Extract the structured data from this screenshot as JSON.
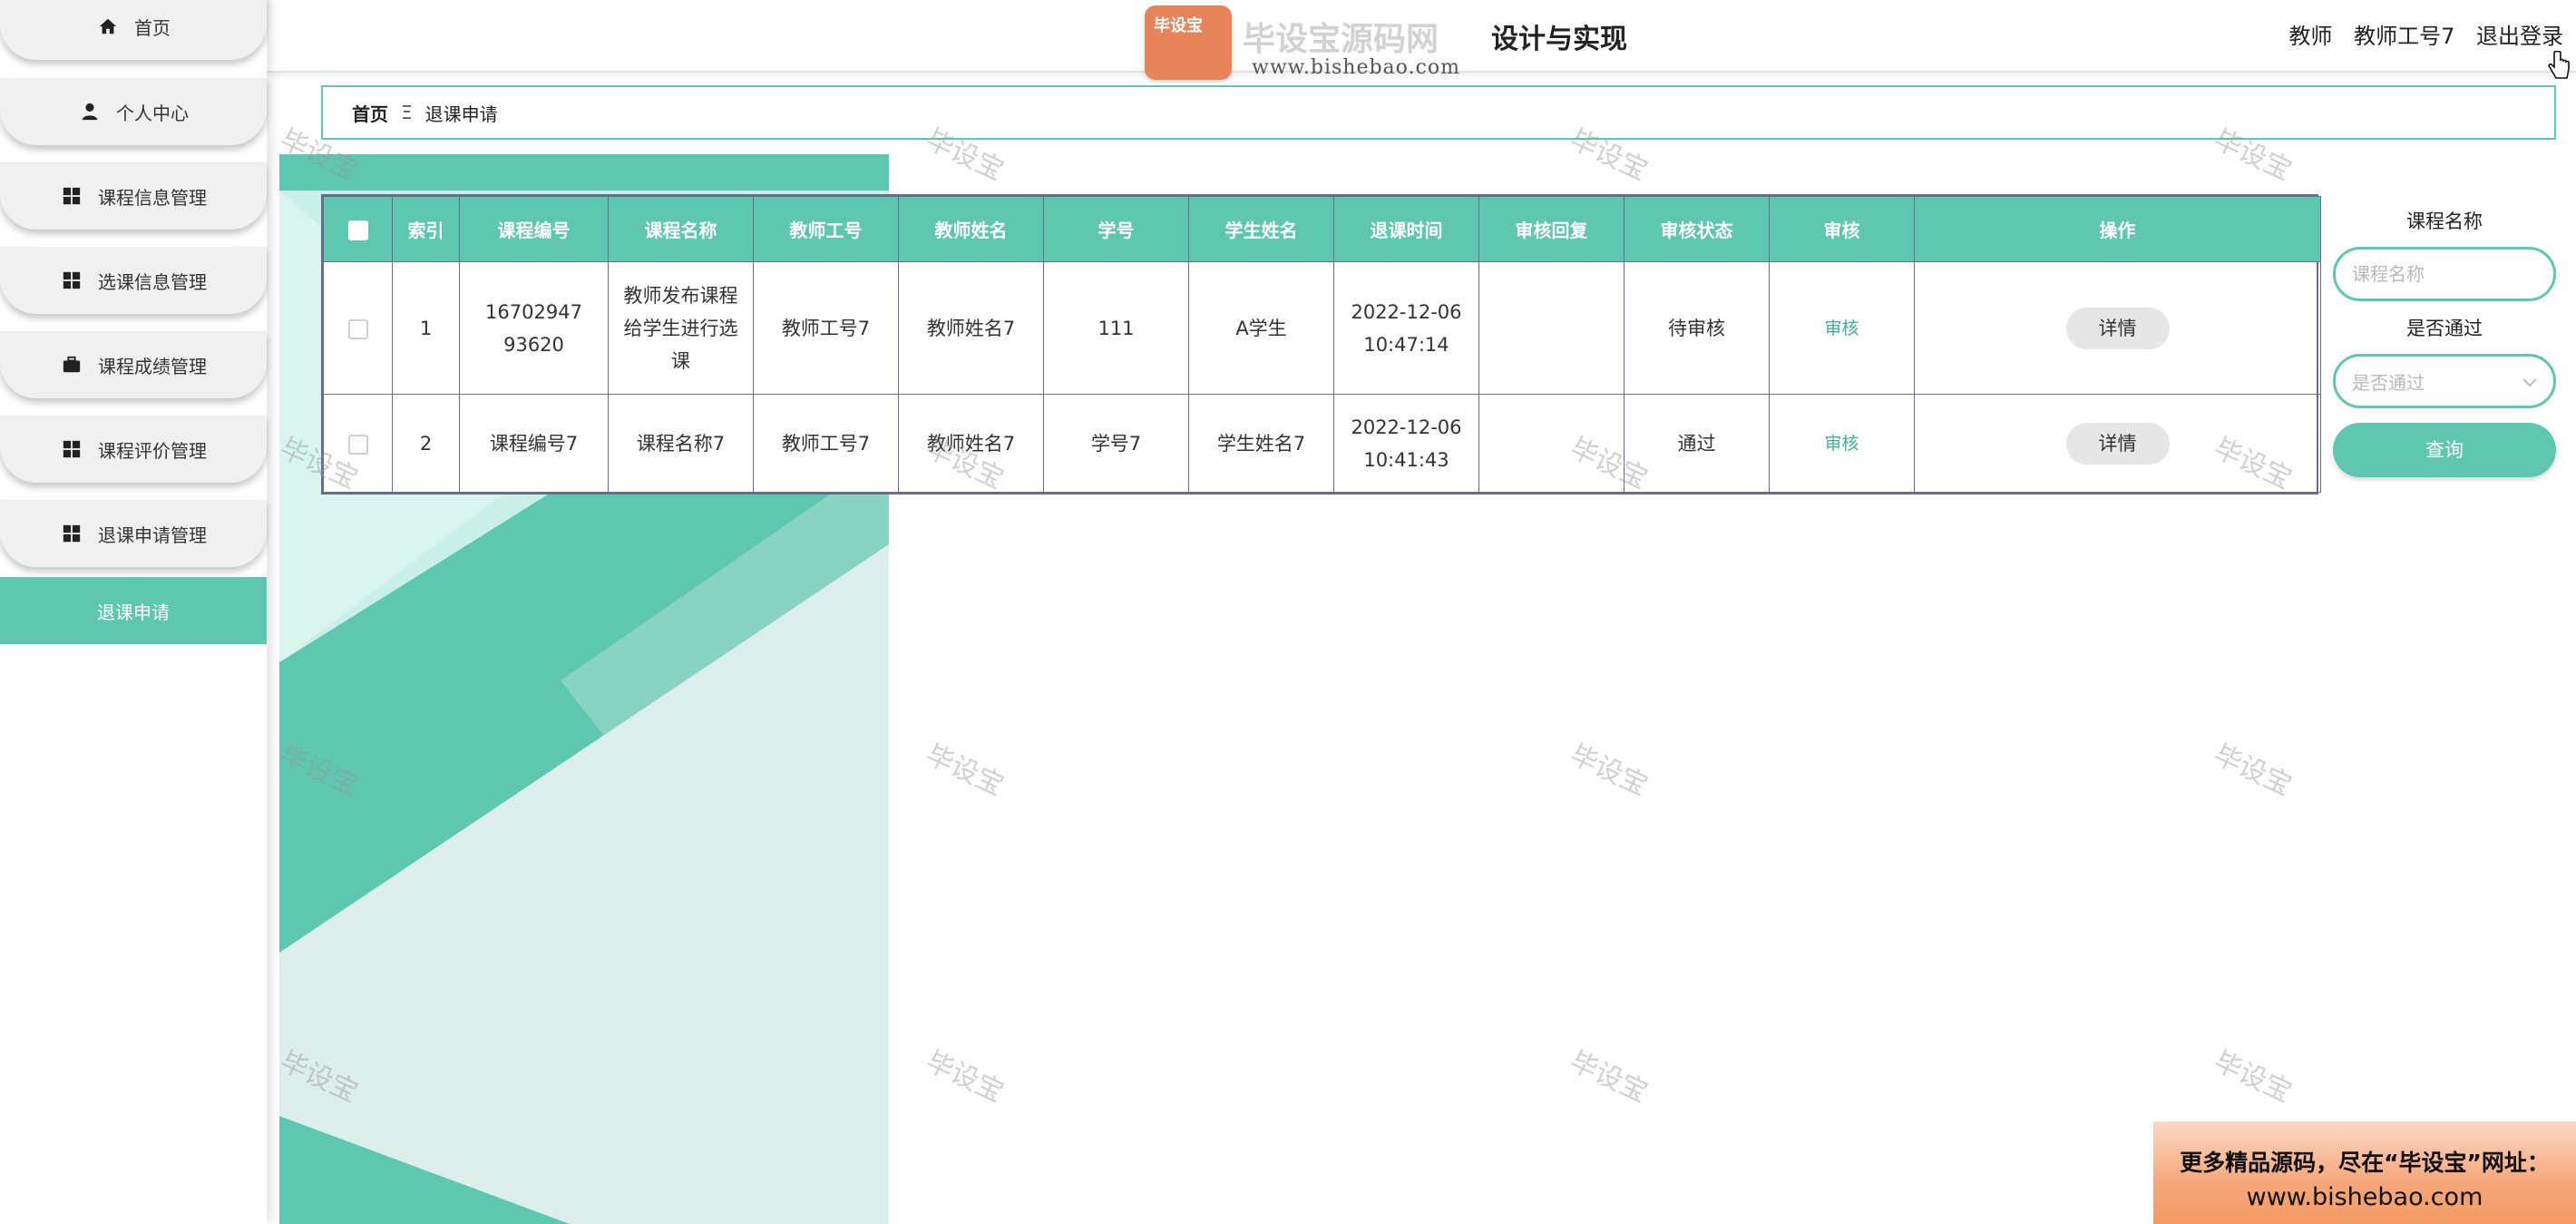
{
  "sidebar": {
    "items": [
      {
        "label": "首页",
        "icon": "home-icon"
      },
      {
        "label": "个人中心",
        "icon": "user-icon"
      },
      {
        "label": "课程信息管理",
        "icon": "grid-icon"
      },
      {
        "label": "选课信息管理",
        "icon": "grid-icon"
      },
      {
        "label": "课程成绩管理",
        "icon": "briefcase-icon"
      },
      {
        "label": "课程评价管理",
        "icon": "grid-icon"
      },
      {
        "label": "退课申请管理",
        "icon": "grid-icon"
      }
    ],
    "subitem": {
      "label": "退课申请"
    }
  },
  "header": {
    "logo_badge": "毕设宝",
    "logo_text": "毕设宝源码网",
    "logo_url": "www.bishebao.com",
    "title": "设计与实现",
    "role": "教师",
    "username": "教师工号7",
    "logout": "退出登录"
  },
  "breadcrumb": {
    "home": "首页",
    "separator": "Ξ",
    "current": "退课申请"
  },
  "table": {
    "columns": [
      "索引",
      "课程编号",
      "课程名称",
      "教师工号",
      "教师姓名",
      "学号",
      "学生姓名",
      "退课时间",
      "审核回复",
      "审核状态",
      "审核",
      "操作"
    ],
    "rows": [
      {
        "index": "1",
        "course_no": "1670294793620",
        "course_name": "教师发布课程给学生进行选课",
        "teacher_no": "教师工号7",
        "teacher_name": "教师姓名7",
        "student_no": "111",
        "student_name": "A学生",
        "drop_date": "2022-12-06",
        "drop_time": "10:47:14",
        "reply": "",
        "status": "待审核",
        "audit": "审核",
        "action": "详情"
      },
      {
        "index": "2",
        "course_no": "课程编号7",
        "course_name": "课程名称7",
        "teacher_no": "教师工号7",
        "teacher_name": "教师姓名7",
        "student_no": "学号7",
        "student_name": "学生姓名7",
        "drop_date": "2022-12-06",
        "drop_time": "10:41:43",
        "reply": "",
        "status": "通过",
        "audit": "审核",
        "action": "详情"
      }
    ]
  },
  "search": {
    "course_label": "课程名称",
    "course_placeholder": "课程名称",
    "pass_label": "是否通过",
    "pass_placeholder": "是否通过",
    "button": "查询"
  },
  "watermark": "毕设宝",
  "promo": {
    "line1": "更多精品源码，尽在“毕设宝”网址：",
    "line2": "www.bishebao.com"
  },
  "colors": {
    "accent": "#5ec7b0",
    "table_border": "#6a6a8a",
    "promo": "#f39a63"
  }
}
